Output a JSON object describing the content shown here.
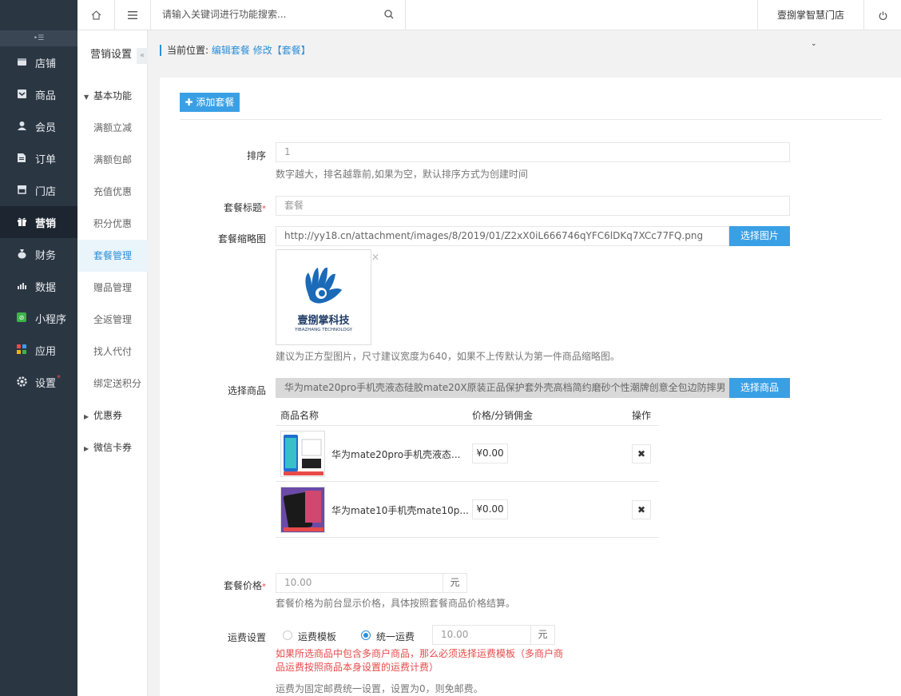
{
  "sidebar": {
    "fold_icon": "fold-icon",
    "items": [
      {
        "label": "店铺",
        "icon": "store-icon"
      },
      {
        "label": "商品",
        "icon": "goods-icon"
      },
      {
        "label": "会员",
        "icon": "member-icon"
      },
      {
        "label": "订单",
        "icon": "order-icon"
      },
      {
        "label": "门店",
        "icon": "shop-icon"
      },
      {
        "label": "营销",
        "icon": "gift-icon",
        "active": true
      },
      {
        "label": "财务",
        "icon": "finance-icon"
      },
      {
        "label": "数据",
        "icon": "chart-icon"
      },
      {
        "label": "小程序",
        "icon": "miniapp-icon"
      },
      {
        "label": "应用",
        "icon": "apps-icon"
      },
      {
        "label": "设置",
        "icon": "gear-icon"
      }
    ]
  },
  "submenu": {
    "title": "营销设置",
    "group_basic": "基本功能",
    "links": [
      "满额立减",
      "满额包邮",
      "充值优惠",
      "积分优惠",
      "套餐管理",
      "赠品管理",
      "全返管理",
      "找人代付",
      "绑定送积分"
    ],
    "group_coupon": "优惠券",
    "group_wechat": "微信卡券"
  },
  "topbar": {
    "search_placeholder": "请输入关键词进行功能搜索...",
    "store_name": "壹捌掌智慧门店"
  },
  "breadcrumb": {
    "prefix": "当前位置:",
    "link": "编辑套餐",
    "current": "修改【套餐】"
  },
  "form": {
    "add_button": "添加套餐",
    "sort": {
      "label": "排序",
      "value": "1",
      "hint": "数字越大，排名越靠前,如果为空，默认排序方式为创建时间"
    },
    "title": {
      "label": "套餐标题",
      "value": "套餐"
    },
    "thumbnail": {
      "label": "套餐缩略图",
      "url": "http://yy18.cn/attachment/images/8/2019/01/Z2xX0iL666746qYFC6lDKq7XCc77FQ.png",
      "button": "选择图片",
      "logo_text": "壹捌掌科技",
      "logo_sub": "YIBAZHANG TECHNOLOGY",
      "hint": "建议为正方型图片，尺寸建议宽度为640，如果不上传默认为第一件商品缩略图。"
    },
    "goods": {
      "label": "选择商品",
      "value": "华为mate20pro手机壳液态硅胶mate20X原装正品保护套外壳高档简约磨砂个性潮牌创意全包边防摔男",
      "button": "选择商品",
      "headers": {
        "name": "商品名称",
        "price": "价格/分销佣金",
        "op": "操作"
      },
      "rows": [
        {
          "name": "华为mate20pro手机壳液态...",
          "price": "¥0.00"
        },
        {
          "name": "华为mate10手机壳mate10p...",
          "price": "¥0.00"
        }
      ]
    },
    "price": {
      "label": "套餐价格",
      "value": "10.00",
      "unit": "元",
      "hint": "套餐价格为前台显示价格，具体按照套餐商品价格结算。"
    },
    "shipping": {
      "label": "运费设置",
      "option_template": "运费模板",
      "option_unified": "统一运费",
      "value": "10.00",
      "unit": "元",
      "warning": "如果所选商品中包含多商户商品，那么必须选择运费模板（多商户商品运费按照商品本身设置的运费计费）",
      "hint": "运费为固定邮费统一设置，设置为0，则免邮费。"
    }
  },
  "colors": {
    "accent": "#3aa0e5",
    "sidebar": "#2b3643",
    "warn": "#e84a4a"
  }
}
